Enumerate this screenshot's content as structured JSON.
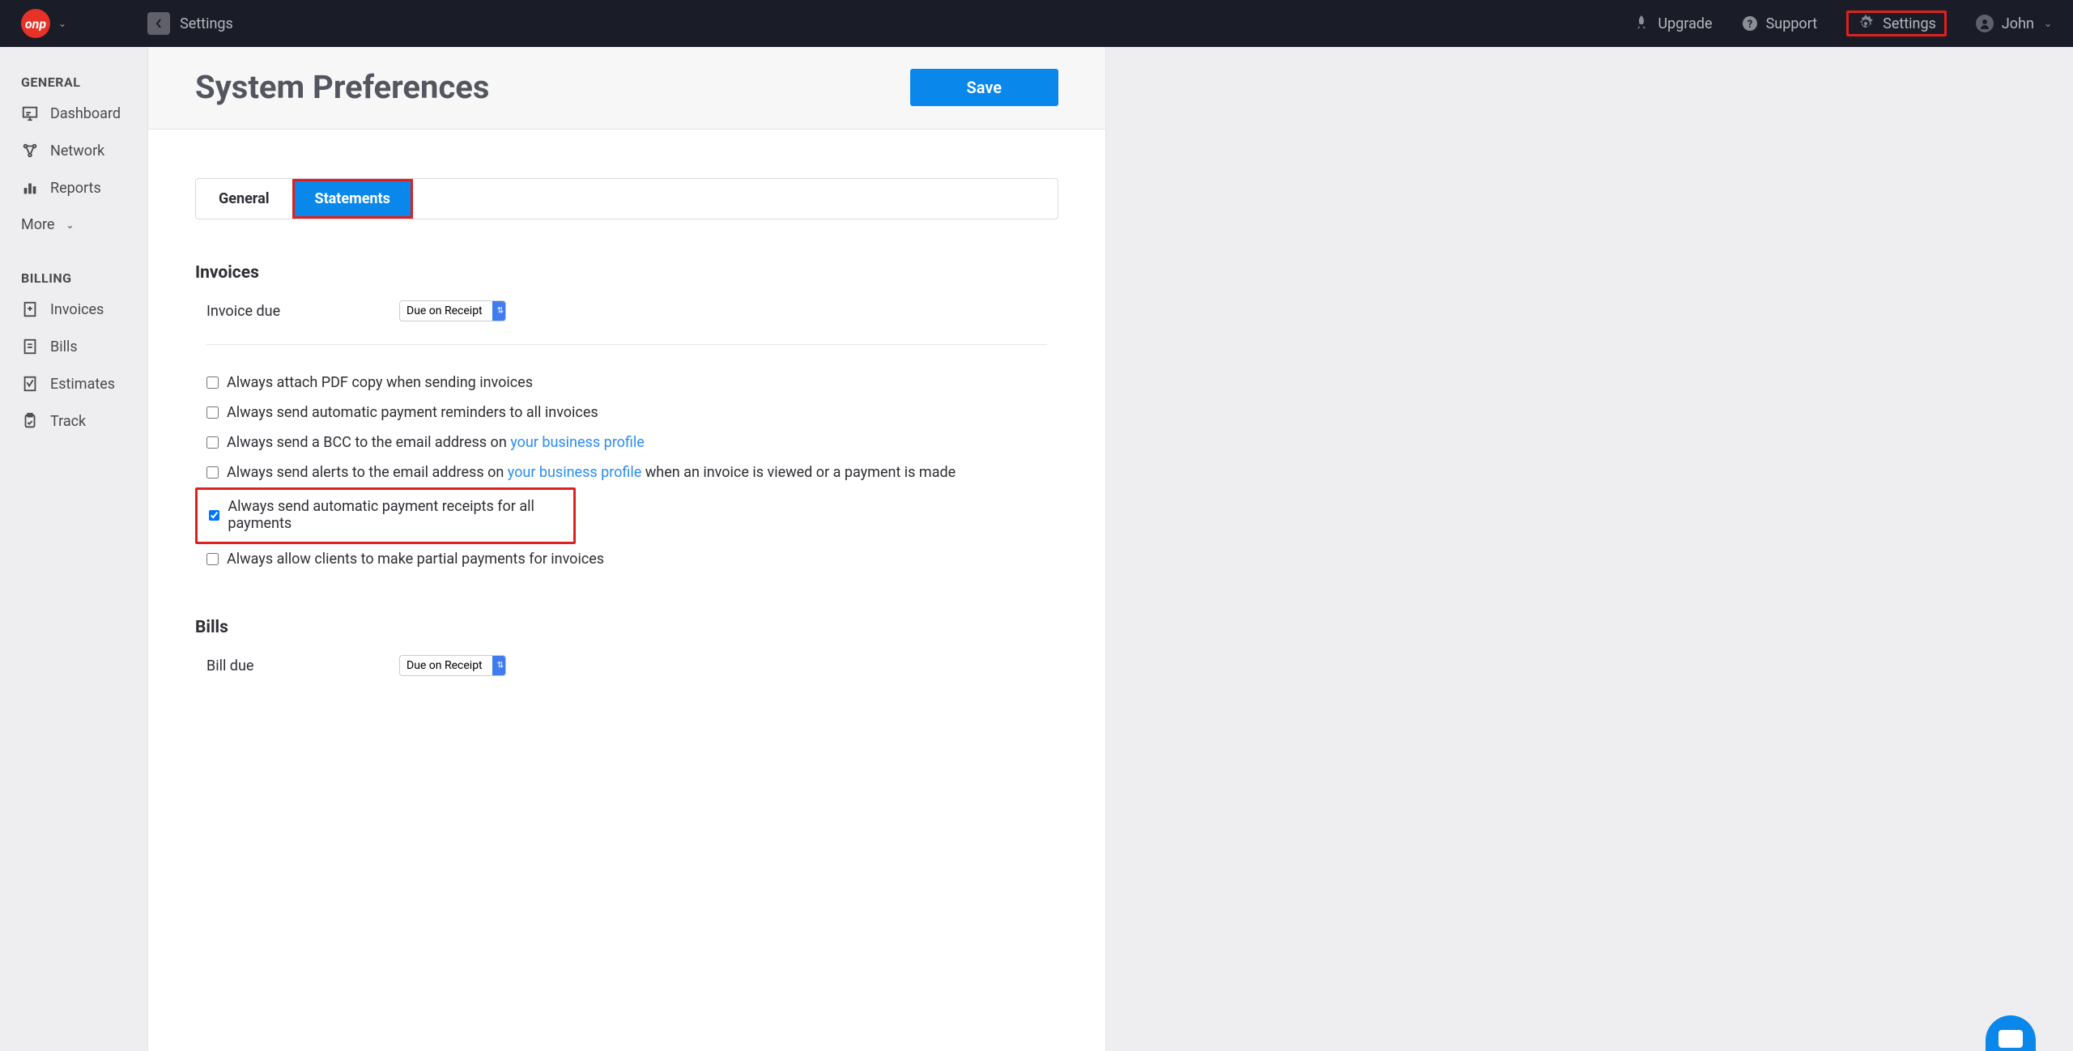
{
  "topbar": {
    "logo": "onp",
    "breadcrumb": "Settings",
    "upgrade": "Upgrade",
    "support": "Support",
    "settings": "Settings",
    "user": "John"
  },
  "sidebar": {
    "general_title": "GENERAL",
    "billing_title": "BILLING",
    "dashboard": "Dashboard",
    "network": "Network",
    "reports": "Reports",
    "more": "More",
    "invoices": "Invoices",
    "bills": "Bills",
    "estimates": "Estimates",
    "track": "Track"
  },
  "page": {
    "title": "System Preferences",
    "save": "Save"
  },
  "tabs": {
    "general": "General",
    "statements": "Statements"
  },
  "invoices": {
    "heading": "Invoices",
    "due_label": "Invoice due",
    "due_value": "Due on Receipt",
    "opt_pdf": "Always attach PDF copy when sending invoices",
    "opt_reminders": "Always send automatic payment reminders to all invoices",
    "opt_bcc_pre": "Always send a BCC to the email address on ",
    "opt_bcc_link": "your business profile",
    "opt_alerts_pre": "Always send alerts to the email address on ",
    "opt_alerts_link": "your business profile",
    "opt_alerts_post": " when an invoice is viewed or a payment is made",
    "opt_receipts": "Always send automatic payment receipts for all payments",
    "opt_partial": "Always allow clients to make partial payments for invoices"
  },
  "bills": {
    "heading": "Bills",
    "due_label": "Bill due",
    "due_value": "Due on Receipt"
  }
}
